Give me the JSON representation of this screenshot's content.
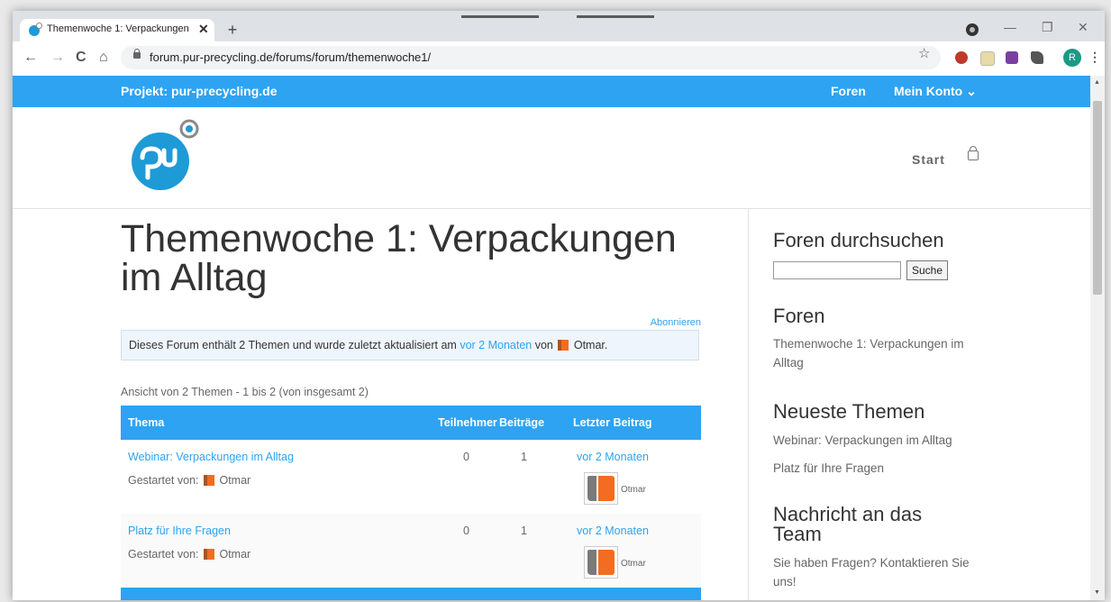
{
  "browser": {
    "tab_title": "Themenwoche 1: Verpackungen i",
    "tab_close": "✕",
    "new_tab": "+",
    "url": "forum.pur-precycling.de/forums/forum/themenwoche1/",
    "profile_initial": "R",
    "back": "←",
    "forward": "→",
    "reload": "C",
    "home": "⌂",
    "bookmark": "☆",
    "minimize": "—",
    "maximize": "❐",
    "close": "✕",
    "menu": "⋮"
  },
  "topbar": {
    "project": "Projekt: pur-precycling.de",
    "nav_forums": "Foren",
    "nav_account": "Mein Konto ⌄"
  },
  "header": {
    "nav_start": "Start"
  },
  "main": {
    "title": "Themenwoche 1: Verpackungen im Alltag",
    "subscribe": "Abonnieren",
    "notice_text": "Dieses Forum enthält 2 Themen und wurde zuletzt aktualisiert am",
    "notice_link": "vor 2 Monaten",
    "notice_von": "von",
    "notice_user": "Otmar.",
    "view_info": "Ansicht von 2 Themen - 1 bis 2 (von insgesamt 2)",
    "table": {
      "headers": {
        "topic": "Thema",
        "participants": "Teilnehmer",
        "posts": "Beiträge",
        "last_post": "Letzter Beitrag"
      },
      "rows": [
        {
          "title": "Webinar: Verpackungen im Alltag",
          "started_by": "Gestartet von:",
          "author": "Otmar",
          "participants": "0",
          "posts": "1",
          "last": "vor 2 Monaten",
          "last_user": "Otmar"
        },
        {
          "title": "Platz für Ihre Fragen",
          "started_by": "Gestartet von:",
          "author": "Otmar",
          "participants": "0",
          "posts": "1",
          "last": "vor 2 Monaten",
          "last_user": "Otmar"
        }
      ]
    }
  },
  "sidebar": {
    "search_heading": "Foren durchsuchen",
    "search_button": "Suche",
    "search_value": "",
    "forums_heading": "Foren",
    "forums_item": "Themenwoche 1: Verpackungen im Alltag",
    "latest_heading": "Neueste Themen",
    "latest_items": [
      "Webinar: Verpackungen im Alltag",
      "Platz für Ihre Fragen"
    ],
    "contact_heading": "Nachricht an das Team",
    "contact_text": "Sie haben Fragen? Kontaktieren Sie uns!"
  },
  "colors": {
    "accent": "#2ea3f2",
    "avatar_orange": "#f36c21"
  }
}
